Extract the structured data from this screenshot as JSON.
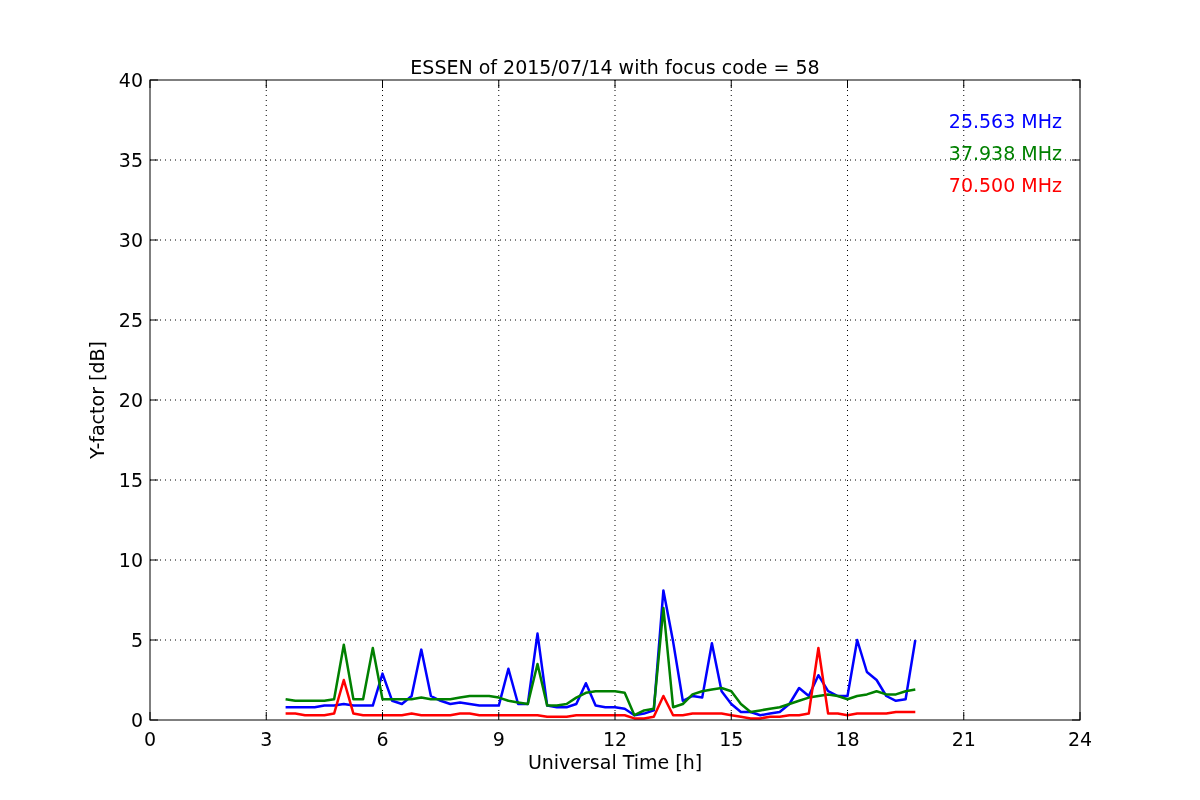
{
  "chart_data": {
    "type": "line",
    "title": "ESSEN of 2015/07/14 with focus code = 58",
    "xlabel": "Universal Time [h]",
    "ylabel": "Y-factor [dB]",
    "x": [
      3.5,
      3.75,
      4,
      4.25,
      4.5,
      4.75,
      5,
      5.25,
      5.5,
      5.75,
      6,
      6.25,
      6.5,
      6.75,
      7,
      7.25,
      7.5,
      7.75,
      8,
      8.25,
      8.5,
      8.75,
      9,
      9.25,
      9.5,
      9.75,
      10,
      10.25,
      10.5,
      10.75,
      11,
      11.25,
      11.5,
      11.75,
      12,
      12.25,
      12.5,
      12.75,
      13,
      13.25,
      13.5,
      13.75,
      14,
      14.25,
      14.5,
      14.75,
      15,
      15.25,
      15.5,
      15.75,
      16,
      16.25,
      16.5,
      16.75,
      17,
      17.25,
      17.5,
      17.75,
      18,
      18.25,
      18.5,
      18.75,
      19,
      19.25,
      19.5,
      19.75
    ],
    "series": [
      {
        "name": "25.563 MHz",
        "color": "#0000ff",
        "values": [
          0.8,
          0.8,
          0.8,
          0.8,
          0.9,
          0.9,
          1.0,
          0.9,
          0.9,
          0.9,
          2.9,
          1.2,
          1.0,
          1.5,
          4.4,
          1.5,
          1.2,
          1.0,
          1.1,
          1.0,
          0.9,
          0.9,
          0.9,
          3.2,
          1.0,
          1.0,
          5.4,
          0.9,
          0.8,
          0.8,
          1.0,
          2.3,
          0.9,
          0.8,
          0.8,
          0.7,
          0.3,
          0.4,
          0.6,
          8.1,
          4.9,
          1.2,
          1.5,
          1.4,
          4.8,
          1.8,
          1.0,
          0.5,
          0.5,
          0.3,
          0.4,
          0.5,
          1.0,
          2.0,
          1.5,
          2.8,
          1.8,
          1.5,
          1.5,
          5.0,
          3.0,
          2.5,
          1.5,
          1.2,
          1.3,
          5.0
        ]
      },
      {
        "name": "37.938 MHz",
        "color": "#008000",
        "values": [
          1.3,
          1.2,
          1.2,
          1.2,
          1.2,
          1.3,
          4.7,
          1.3,
          1.3,
          4.5,
          1.3,
          1.3,
          1.3,
          1.3,
          1.4,
          1.3,
          1.3,
          1.3,
          1.4,
          1.5,
          1.5,
          1.5,
          1.4,
          1.2,
          1.1,
          1.0,
          3.5,
          0.9,
          0.9,
          1.0,
          1.4,
          1.7,
          1.8,
          1.8,
          1.8,
          1.7,
          0.3,
          0.6,
          0.7,
          7.0,
          0.8,
          1.0,
          1.6,
          1.8,
          1.9,
          2.0,
          1.8,
          1.0,
          0.5,
          0.6,
          0.7,
          0.8,
          1.0,
          1.2,
          1.4,
          1.5,
          1.6,
          1.5,
          1.3,
          1.5,
          1.6,
          1.8,
          1.6,
          1.6,
          1.8,
          1.9
        ]
      },
      {
        "name": "70.500 MHz",
        "color": "#ff0000",
        "values": [
          0.4,
          0.4,
          0.3,
          0.3,
          0.3,
          0.4,
          2.5,
          0.4,
          0.3,
          0.3,
          0.3,
          0.3,
          0.3,
          0.4,
          0.3,
          0.3,
          0.3,
          0.3,
          0.4,
          0.4,
          0.3,
          0.3,
          0.3,
          0.3,
          0.3,
          0.3,
          0.3,
          0.2,
          0.2,
          0.2,
          0.3,
          0.3,
          0.3,
          0.3,
          0.3,
          0.3,
          0.1,
          0.1,
          0.2,
          1.5,
          0.3,
          0.3,
          0.4,
          0.4,
          0.4,
          0.4,
          0.3,
          0.2,
          0.1,
          0.1,
          0.2,
          0.2,
          0.3,
          0.3,
          0.4,
          4.5,
          0.4,
          0.4,
          0.3,
          0.4,
          0.4,
          0.4,
          0.4,
          0.5,
          0.5,
          0.5
        ]
      }
    ],
    "xlim": [
      0,
      24
    ],
    "ylim": [
      0,
      40
    ],
    "xticks": [
      0,
      3,
      6,
      9,
      12,
      15,
      18,
      21,
      24
    ],
    "yticks": [
      0,
      5,
      10,
      15,
      20,
      25,
      30,
      35,
      40
    ],
    "grid": true
  }
}
